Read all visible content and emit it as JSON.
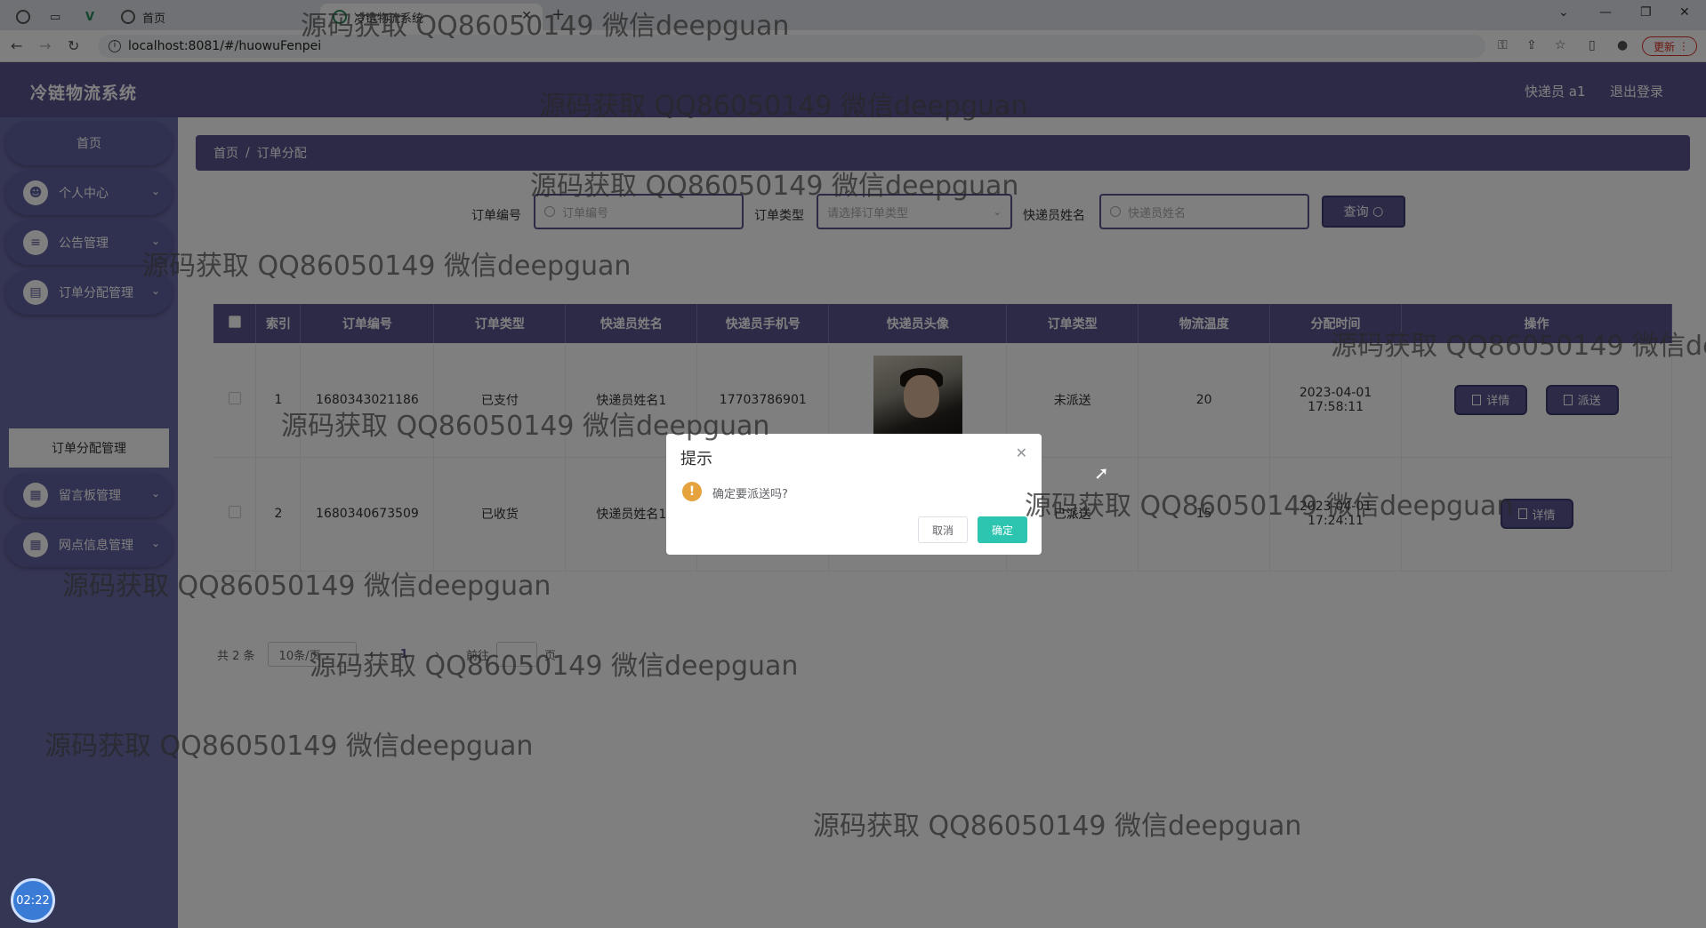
{
  "browser": {
    "tabs": [
      {
        "label": "首页"
      },
      {
        "label": "冷链物流系统"
      }
    ],
    "url": "localhost:8081/#/huowuFenpei",
    "update_label": "更新"
  },
  "app": {
    "brand": "冷链物流系统",
    "user": "快递员 a1",
    "logout": "退出登录"
  },
  "sidebar": {
    "items": [
      {
        "label": "首页"
      },
      {
        "label": "个人中心"
      },
      {
        "label": "公告管理"
      },
      {
        "label": "订单分配管理"
      },
      {
        "label": "留言板管理"
      },
      {
        "label": "网点信息管理"
      }
    ],
    "sub_active": "订单分配管理"
  },
  "breadcrumb": {
    "home": "首页",
    "sep": "/",
    "current": "订单分配"
  },
  "search": {
    "order_no_label": "订单编号",
    "order_no_placeholder": "订单编号",
    "order_type_label": "订单类型",
    "order_type_placeholder": "请选择订单类型",
    "courier_label": "快递员姓名",
    "courier_placeholder": "快递员姓名",
    "query_label": "查询"
  },
  "table": {
    "headers": [
      "索引",
      "订单编号",
      "订单类型",
      "快递员姓名",
      "快递员手机号",
      "快递员头像",
      "订单类型",
      "物流温度",
      "分配时间",
      "操作"
    ],
    "rows": [
      {
        "index": "1",
        "order_no": "1680343021186",
        "type": "已支付",
        "courier": "快递员姓名1",
        "phone": "17703786901",
        "status": "未派送",
        "temp": "20",
        "time": "2023-04-01 17:58:11"
      },
      {
        "index": "2",
        "order_no": "1680340673509",
        "type": "已收货",
        "courier": "快递员姓名1",
        "phone": "",
        "status": "已派送",
        "temp": "15",
        "time": "2023-04-01 17:24:11"
      }
    ],
    "detail_label": "详情",
    "dispatch_label": "派送"
  },
  "pagination": {
    "total": "共 2 条",
    "per_page": "10条/页",
    "current": "1",
    "goto": "前往",
    "page_suffix": "页"
  },
  "dialog": {
    "title": "提示",
    "message": "确定要派送吗?",
    "cancel": "取消",
    "confirm": "确定"
  },
  "watermark": "源码获取 QQ86050149 微信deepguan",
  "timer": "02:22"
}
